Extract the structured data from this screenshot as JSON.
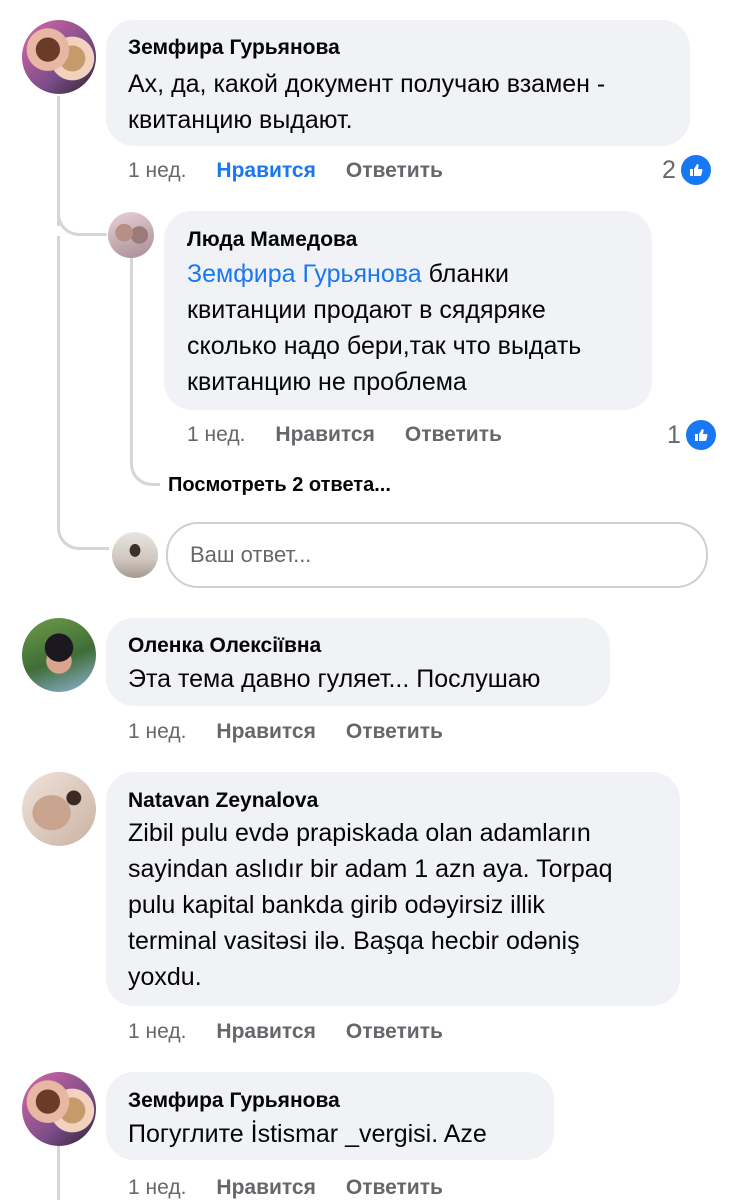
{
  "comments": [
    {
      "author": "Земфира Гурьянова",
      "lines": [
        "Ах, да, какой документ получаю взамен -",
        "квитанцию выдают."
      ],
      "time": "1 нед.",
      "like_label": "Нравится",
      "reply_label": "Ответить",
      "reactions": "2"
    },
    {
      "author": "Люда Мамедова",
      "mention": "Земфира Гурьянова",
      "lines": [
        " бланки",
        "квитанции продают в сядяряке",
        "сколько надо бери,так что выдать",
        "квитанцию не проблема"
      ],
      "time": "1 нед.",
      "like_label": "Нравится",
      "reply_label": "Ответить",
      "reactions": "1"
    },
    {
      "author": "Оленка Олексіївна",
      "lines": [
        "Эта тема давно гуляет... Послушаю"
      ],
      "time": "1 нед.",
      "like_label": "Нравится",
      "reply_label": "Ответить"
    },
    {
      "author": "Natavan Zeynalova",
      "lines": [
        "Zibil pulu evdə prapiskada olan adamların",
        "sayindan aslıdır bir adam 1 azn aya. Torpaq",
        "pulu kapital bankda girib odəyirsiz illik",
        "terminal vasitəsi ilə. Başqa hecbir odəniş",
        "yoxdu."
      ],
      "time": "1 нед.",
      "like_label": "Нравится",
      "reply_label": "Ответить"
    },
    {
      "author": "Земфира Гурьянова",
      "lines": [
        "Погуглите İstismar _vergisi. Aze"
      ],
      "time": "1 нед.",
      "like_label": "Нравится",
      "reply_label": "Ответить"
    }
  ],
  "view_more_replies": "Посмотреть 2 ответа...",
  "reply_input": {
    "placeholder": "Ваш ответ..."
  },
  "colors": {
    "accent": "#1877f2",
    "bubble": "#f0f2f5",
    "meta": "#65676b"
  },
  "icons": {
    "like_badge": "thumbs-up-icon"
  }
}
